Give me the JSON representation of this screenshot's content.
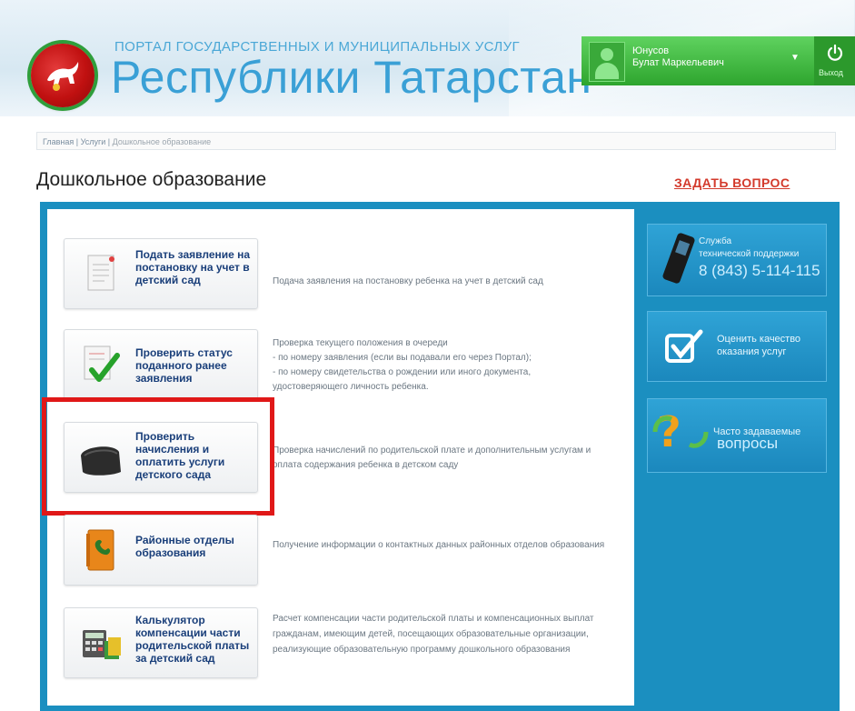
{
  "header": {
    "portal_small": "ПОРТАЛ ГОСУДАРСТВЕННЫХ И МУНИЦИПАЛЬНЫХ УСЛУГ",
    "portal_big": "Республики Татарстан",
    "user_line1": "Юнусов",
    "user_line2": "Булат Маркельевич",
    "logout_label": "Выход"
  },
  "breadcrumb": {
    "home": "Главная",
    "sep": " | ",
    "services": "Услуги",
    "current": "Дошкольное образование"
  },
  "page": {
    "title": "Дошкольное образование",
    "ask_link": "ЗАДАТЬ ВОПРОС"
  },
  "services": [
    {
      "label": "Подать заявление на постановку на учет в детский сад",
      "desc": "Подача заявления на постановку ребенка на учет в детский сад"
    },
    {
      "label": "Проверить статус поданного ранее заявления",
      "desc_lines": [
        "Проверка текущего положения в очереди",
        "- по номеру заявления (если вы подавали его через Портал);",
        "- по номеру свидетельства о рождении или иного документа,",
        "удостоверяющего личность ребенка."
      ]
    },
    {
      "label": "Проверить начисления и оплатить услуги детского сада",
      "desc": "Проверка начислений по родительской плате и дополнительным услугам и оплата содержания ребенка в детском саду"
    },
    {
      "label": "Районные отделы образования",
      "desc": "Получение информации о контактных данных районных отделов образования"
    },
    {
      "label": "Калькулятор компенсации части родительской платы за детский сад",
      "desc": "Расчет компенсации части родительской платы и компенсационных выплат гражданам, имеющим детей, посещающих образовательные организации, реализующие образовательную программу дошкольного образования"
    }
  ],
  "sidebar": {
    "support_line1": "Служба",
    "support_line2": "технической поддержки",
    "support_phone": "8 (843) 5-114-115",
    "rate_line1": "Оценить качество",
    "rate_line2": "оказания услуг",
    "faq_line1": "Часто задаваемые",
    "faq_line2": "вопросы"
  },
  "colors": {
    "accent_blue": "#1b8fc0",
    "user_green": "#2ea52e",
    "highlight_red": "#e01818",
    "link_red": "#d33a2c",
    "service_text": "#1a3f7a"
  }
}
